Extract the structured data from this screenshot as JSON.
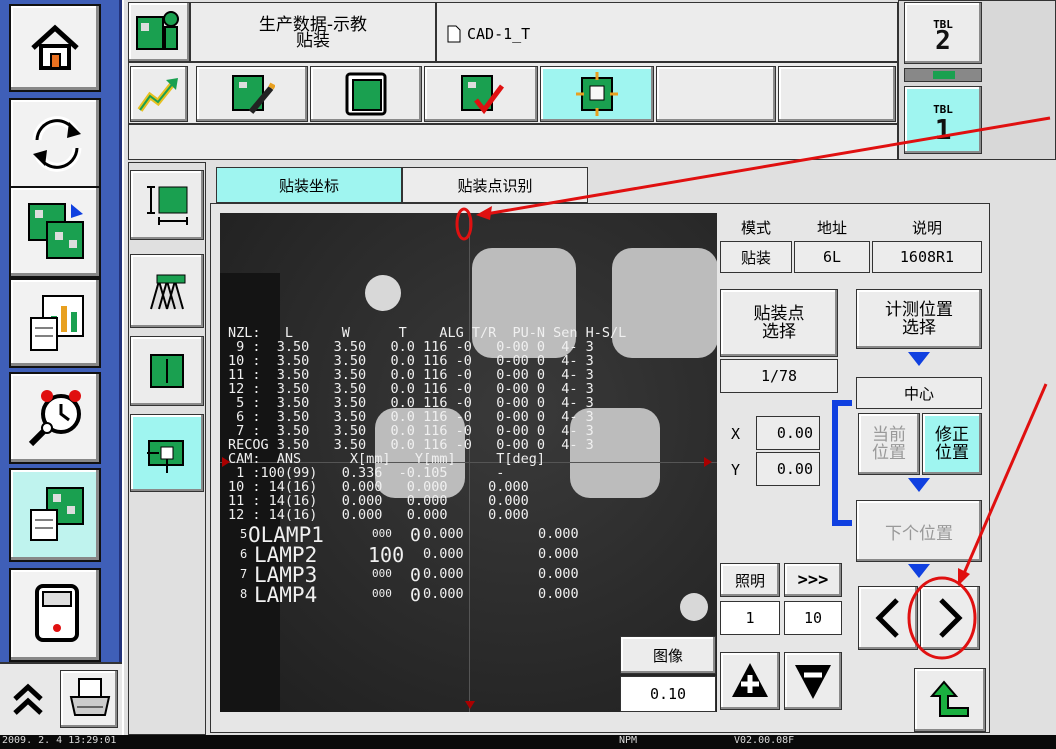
{
  "header": {
    "title": "生产数据-示教",
    "subtitle": "贴装",
    "file": "CAD-1_T"
  },
  "tbl": {
    "label": "TBL",
    "top_num": "2",
    "bottom_num": "1"
  },
  "tabs": [
    {
      "label": "贴装坐标"
    },
    {
      "label": "贴装点识别"
    }
  ],
  "info": {
    "mode_label": "模式",
    "addr_label": "地址",
    "desc_label": "说明",
    "mode_value": "贴装",
    "addr_value": "6L",
    "desc_value": "1608R1"
  },
  "buttons": {
    "select_point": "贴装点\n选择",
    "measure_pos": "计测位置\n选择",
    "center": "中心",
    "current_pos": "当前\n位置",
    "fix_pos": "修正\n位置",
    "next_pos": "下个位置",
    "light": "照明",
    "fast": ">>>",
    "image": "图像"
  },
  "counter": "1/78",
  "coords": {
    "x_label": "X",
    "x_value": "0.00",
    "y_label": "Y",
    "y_value": "0.00"
  },
  "light_values": {
    "a": "1",
    "b": "10"
  },
  "image_value": "0.10",
  "overlay": {
    "nzl_header": "NZL:   L      W      T    ALG T/R  PU-N Sen H-S/L",
    "nzl_rows": [
      " 9 :  3.50   3.50   0.0 116 -0   0-00 0  4- 3",
      "10 :  3.50   3.50   0.0 116 -0   0-00 0  4- 3",
      "11 :  3.50   3.50   0.0 116 -0   0-00 0  4- 3",
      "12 :  3.50   3.50   0.0 116 -0   0-00 0  4- 3",
      " 5 :  3.50   3.50   0.0 116 -0   0-00 0  4- 3",
      " 6 :  3.50   3.50   0.0 116 -0   0-00 0  4- 3",
      " 7 :  3.50   3.50   0.0 116 -0   0-00 0  4- 3",
      "RECOG 3.50   3.50   0.0 116 -0   0-00 0  4- 3"
    ],
    "cam_header": "CAM:  ANS      X[mm]   Y[mm]     T[deg]",
    "cam_rows": [
      " 1 :100(99)   0.336  -0.105      -",
      "10 : 14(16)   0.000   0.000     0.000",
      "11 : 14(16)   0.000   0.000     0.000",
      "12 : 14(16)   0.000   0.000     0.000"
    ],
    "lamp_rows": [
      {
        "n": "5",
        "label": "OLAMP1",
        "val": "000",
        "z": "0",
        "v2": "0.000",
        "t": "0.000"
      },
      {
        "n": "6",
        "label": "LAMP2",
        "val": "100",
        "z": "",
        "v2": "0.000",
        "t": "0.000"
      },
      {
        "n": "7",
        "label": "LAMP3",
        "val": "000",
        "z": "0",
        "v2": "0.000",
        "t": "0.000"
      },
      {
        "n": "8",
        "label": "LAMP4",
        "val": "000",
        "z": "0",
        "v2": "0.000",
        "t": "0.000"
      }
    ]
  },
  "status": {
    "datetime": "2009.  2.  4 13:29:01",
    "mode": "NPM",
    "version": "V02.00.08F"
  },
  "colors": {
    "sidebar": "#3f5fb8",
    "active": "#9ff5f0",
    "annotation": "#e01010",
    "accent_blue": "#1040e0"
  }
}
